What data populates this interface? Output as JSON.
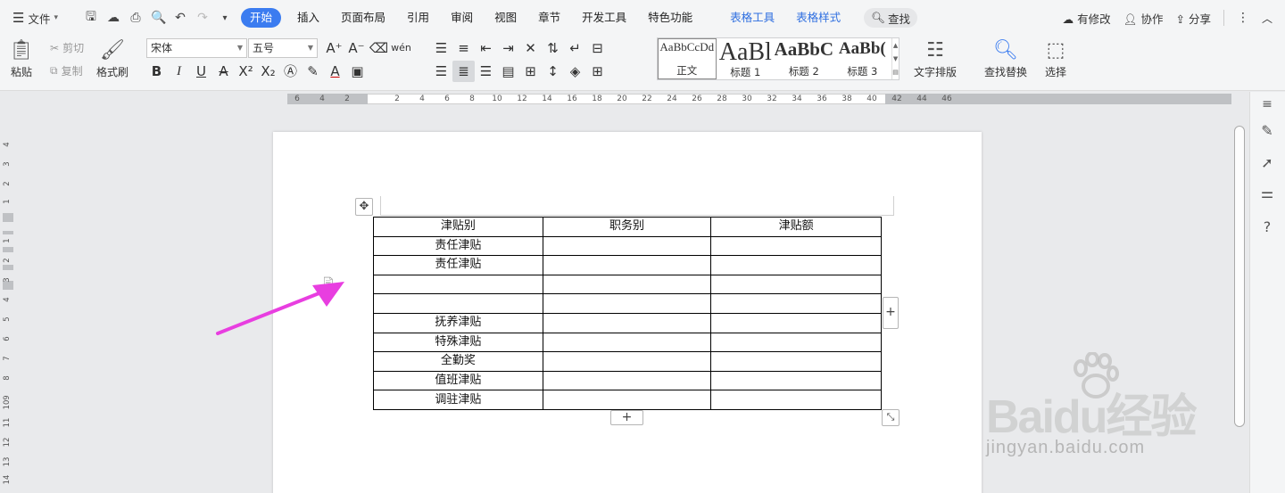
{
  "menubar": {
    "file_label": "文件",
    "tabs": [
      {
        "label": "开始",
        "active": true
      },
      {
        "label": "插入"
      },
      {
        "label": "页面布局"
      },
      {
        "label": "引用"
      },
      {
        "label": "审阅"
      },
      {
        "label": "视图"
      },
      {
        "label": "章节"
      },
      {
        "label": "开发工具"
      },
      {
        "label": "特色功能"
      }
    ],
    "context_tabs": [
      {
        "label": "表格工具"
      },
      {
        "label": "表格样式"
      }
    ],
    "search_label": "查找",
    "right": {
      "modified": "有修改",
      "collab": "协作",
      "share": "分享"
    }
  },
  "ribbon": {
    "paste": "粘贴",
    "cut": "剪切",
    "copy": "复制",
    "format_painter": "格式刷",
    "font_name": "宋体",
    "font_size": "五号",
    "styles": [
      {
        "sample": "AaBbCcDd",
        "name": "正文"
      },
      {
        "sample": "AaBl",
        "name": "标题 1"
      },
      {
        "sample": "AaBbC",
        "name": "标题 2"
      },
      {
        "sample": "AaBb(",
        "name": "标题 3"
      }
    ],
    "text_layout": "文字排版",
    "find_replace": "查找替换",
    "select": "选择"
  },
  "ruler": {
    "h_ticks": [
      "6",
      "4",
      "2",
      "2",
      "4",
      "6",
      "8",
      "10",
      "12",
      "14",
      "16",
      "18",
      "20",
      "22",
      "24",
      "26",
      "28",
      "30",
      "32",
      "34",
      "36",
      "38",
      "40",
      "42",
      "44",
      "46"
    ],
    "v_ticks": [
      "4",
      "3",
      "2",
      "1",
      "1",
      "2",
      "3",
      "4",
      "5",
      "6",
      "7",
      "8",
      "9",
      "10",
      "11",
      "12",
      "13",
      "14"
    ]
  },
  "table": {
    "rows": [
      [
        "津贴别",
        "职务别",
        "津贴额"
      ],
      [
        "责任津贴",
        "",
        ""
      ],
      [
        "责任津贴",
        "",
        ""
      ],
      [
        "",
        "",
        ""
      ],
      [
        "",
        "",
        ""
      ],
      [
        "抚养津贴",
        "",
        ""
      ],
      [
        "特殊津贴",
        "",
        ""
      ],
      [
        "全勤奖",
        "",
        ""
      ],
      [
        "值班津贴",
        "",
        ""
      ],
      [
        "调驻津贴",
        "",
        ""
      ]
    ],
    "add_symbol": "+"
  },
  "watermark": {
    "brand": "Baidu经验",
    "url": "jingyan.baidu.com"
  },
  "colors": {
    "accent": "#3b7cf0",
    "arrow": "#e83ee0",
    "context_tab": "#2f6fe0"
  }
}
